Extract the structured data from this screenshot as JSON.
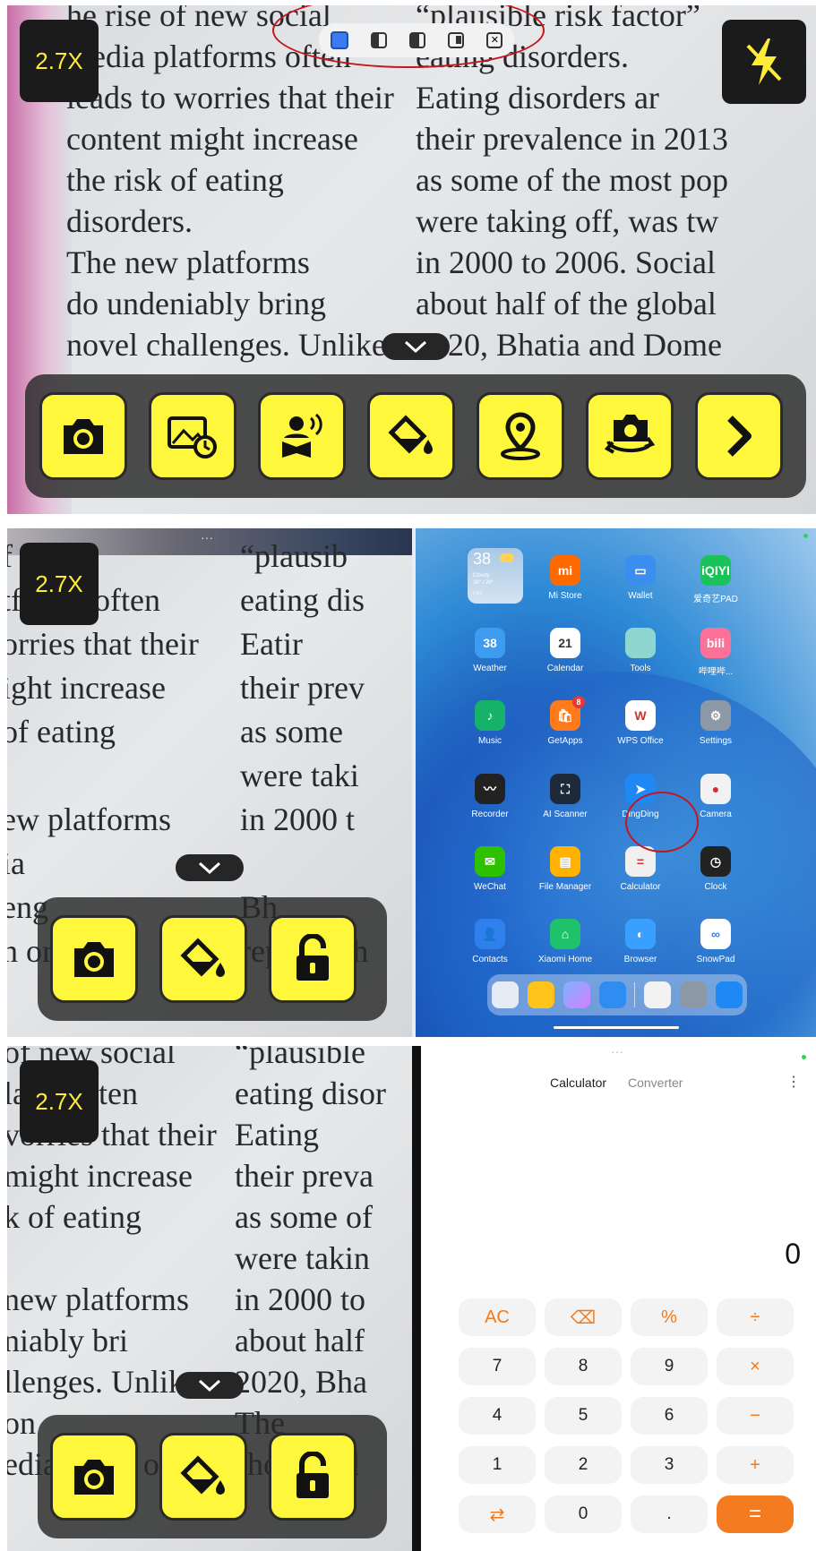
{
  "zoom_label": "2.7X",
  "page_text": {
    "p1_left": [
      "he rise of new social",
      "media platforms often",
      "leads to worries that their",
      "content might increase",
      "the risk of eating",
      "disorders.",
      "The new platforms",
      "do undeniably bring",
      "novel challenges. Unlike"
    ],
    "p1_right": [
      "“plausible risk factor”",
      "eating disorders.",
      "Eating disorders ar",
      "their prevalence in 2013",
      "as some of the most pop",
      "were taking off, was tw",
      "in 2000 to 2006. Social",
      "about half of the global",
      "2020, Bhatia and Dome"
    ],
    "p2_left": [
      "f social",
      "tforms often",
      "orries that their",
      "ight increase",
      "of eating",
      "",
      "ew platforms",
      "ia",
      "eng",
      "n or print,"
    ],
    "p2_right": [
      "“plausib",
      "eating dis",
      "Eatir",
      "their prev",
      "as some",
      "were taki",
      "in 2000 t",
      "",
      "Bh",
      "report. Th"
    ],
    "p3_left": [
      "of new social",
      "la   ns often",
      "vorries that their",
      "might increase",
      "k of eating",
      "",
      "new platforms",
      "niably bri",
      "llenges. Unlike",
      "on",
      "edia relies on"
    ],
    "p3_right": [
      "“plausible",
      "eating disor",
      "Eating",
      "their preva",
      "as some of",
      "were takin",
      "in 2000 to",
      "about half",
      "2020, Bha",
      "The",
      "should ad"
    ]
  },
  "panel1_buttons": [
    "camera-icon",
    "gallery-history-icon",
    "read-aloud-icon",
    "color-fill-icon",
    "location-icon",
    "switch-camera-icon",
    "next-chevron-icon"
  ],
  "panel2_buttons": [
    "camera-icon",
    "color-fill-icon",
    "unlock-icon"
  ],
  "launcher": {
    "weather_widget": {
      "temp": "38",
      "cond": "Cloudy",
      "range": "38° / 29°",
      "extra": "PM2"
    },
    "apps": [
      {
        "label": "Mi Store",
        "color": "#ff6a00",
        "glyph": "mi"
      },
      {
        "label": "Wallet",
        "color": "#3a8ef0",
        "glyph": "▭"
      },
      {
        "label": "爱奇艺PAD",
        "color": "#19c35a",
        "glyph": "iQIYI"
      },
      {
        "label": "Weather",
        "color": "#3d9bf0",
        "glyph": "38"
      },
      {
        "label": "Calendar",
        "color": "#ffffff",
        "glyph": "21"
      },
      {
        "label": "Tools",
        "color": "#8fd6d0",
        "glyph": ""
      },
      {
        "label": "哔哩哔...",
        "color": "#fb7299",
        "glyph": "bili"
      },
      {
        "label": "Music",
        "color": "#17b26a",
        "glyph": "♪"
      },
      {
        "label": "GetApps",
        "color": "#ff7a1a",
        "glyph": "🛍"
      },
      {
        "label": "WPS Office",
        "color": "#ffffff",
        "glyph": "W"
      },
      {
        "label": "Settings",
        "color": "#8d98a6",
        "glyph": "⚙"
      },
      {
        "label": "Recorder",
        "color": "#222222",
        "glyph": "〰"
      },
      {
        "label": "AI Scanner",
        "color": "#1e2a3a",
        "glyph": "⛶"
      },
      {
        "label": "DingDing",
        "color": "#1e88f5",
        "glyph": "➤"
      },
      {
        "label": "Camera",
        "color": "#f2f2f2",
        "glyph": "●"
      },
      {
        "label": "WeChat",
        "color": "#2dc100",
        "glyph": "✉"
      },
      {
        "label": "File Manager",
        "color": "#ffb300",
        "glyph": "▤"
      },
      {
        "label": "Calculator",
        "color": "#f0f0f0",
        "glyph": "="
      },
      {
        "label": "Clock",
        "color": "#222222",
        "glyph": "◷"
      },
      {
        "label": "Contacts",
        "color": "#2f80ed",
        "glyph": "👤"
      },
      {
        "label": "Xiaomi Home",
        "color": "#1fc16b",
        "glyph": "⌂"
      },
      {
        "label": "Browser",
        "color": "#3aa0ff",
        "glyph": "◐"
      },
      {
        "label": "SnowPad",
        "color": "#ffffff",
        "glyph": "∞"
      }
    ],
    "getapps_badge": "8",
    "calendar_day": "THU"
  },
  "calculator": {
    "tabs": [
      "Calculator",
      "Converter"
    ],
    "menu": "⋮",
    "display": "0",
    "keys": [
      [
        "AC",
        "⌫",
        "%",
        "÷"
      ],
      [
        "7",
        "8",
        "9",
        "×"
      ],
      [
        "4",
        "5",
        "6",
        "−"
      ],
      [
        "1",
        "2",
        "3",
        "+"
      ],
      [
        "⇄",
        "0",
        ".",
        "="
      ]
    ]
  }
}
